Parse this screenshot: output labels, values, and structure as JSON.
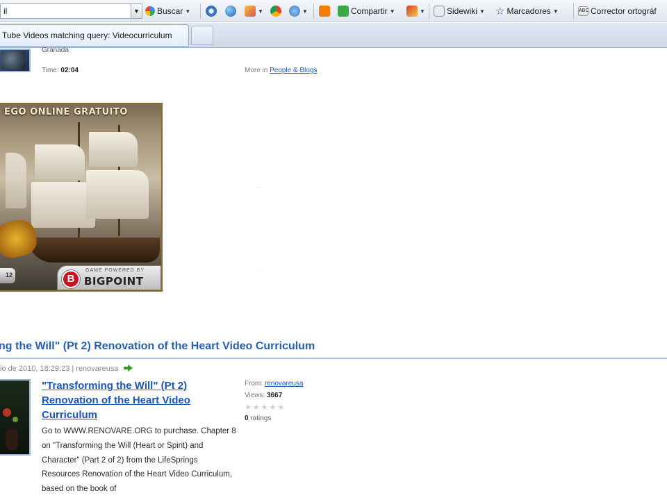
{
  "toolbar": {
    "search_value": "il",
    "buscar_label": "Buscar",
    "compartir_label": "Compartir",
    "sidewiki_label": "Sidewiki",
    "marcadores_label": "Marcadores",
    "corrector_label": "Corrector ortográf"
  },
  "tabs": {
    "active_title": "Tube Videos matching query: Videocurriculum"
  },
  "top_result": {
    "location": "Granada",
    "time_label": "Time:",
    "time_value": "02:04",
    "more_in_label": "More in",
    "category": "People & Blogs"
  },
  "ad": {
    "headline": "EGO ONLINE GRATUITO",
    "powered_by": "GAME POWERED BY",
    "brand": "BIGPOINT",
    "logo_letter": "B",
    "play_number": "12"
  },
  "video": {
    "heading": "ng the Will\" (Pt 2) Renovation of the Heart Video Curriculum",
    "date": "io de 2010, 18:29:23 | renovareusa",
    "title": "\"Transforming the Will\" (Pt 2) Renovation of the Heart Video Curriculum",
    "description": "Go to WWW.RENOVARE.ORG to purchase. Chapter 8 on \"Transforming the Will (Heart or Spirit) and Character\" (Part 2 of 2) from the LifeSprings Resources Renovation of the Heart Video Curriculum, based on the book of",
    "from_label": "From:",
    "from_user": "renovareusa",
    "views_label": "Views:",
    "views_value": "3667",
    "stars": "★★★★★",
    "ratings_value": "0",
    "ratings_label": "ratings"
  },
  "colors": {
    "link": "#1a56b8",
    "heading": "#2760b0",
    "ad_logo": "#c8141e",
    "go_arrow": "#3c9a26"
  }
}
